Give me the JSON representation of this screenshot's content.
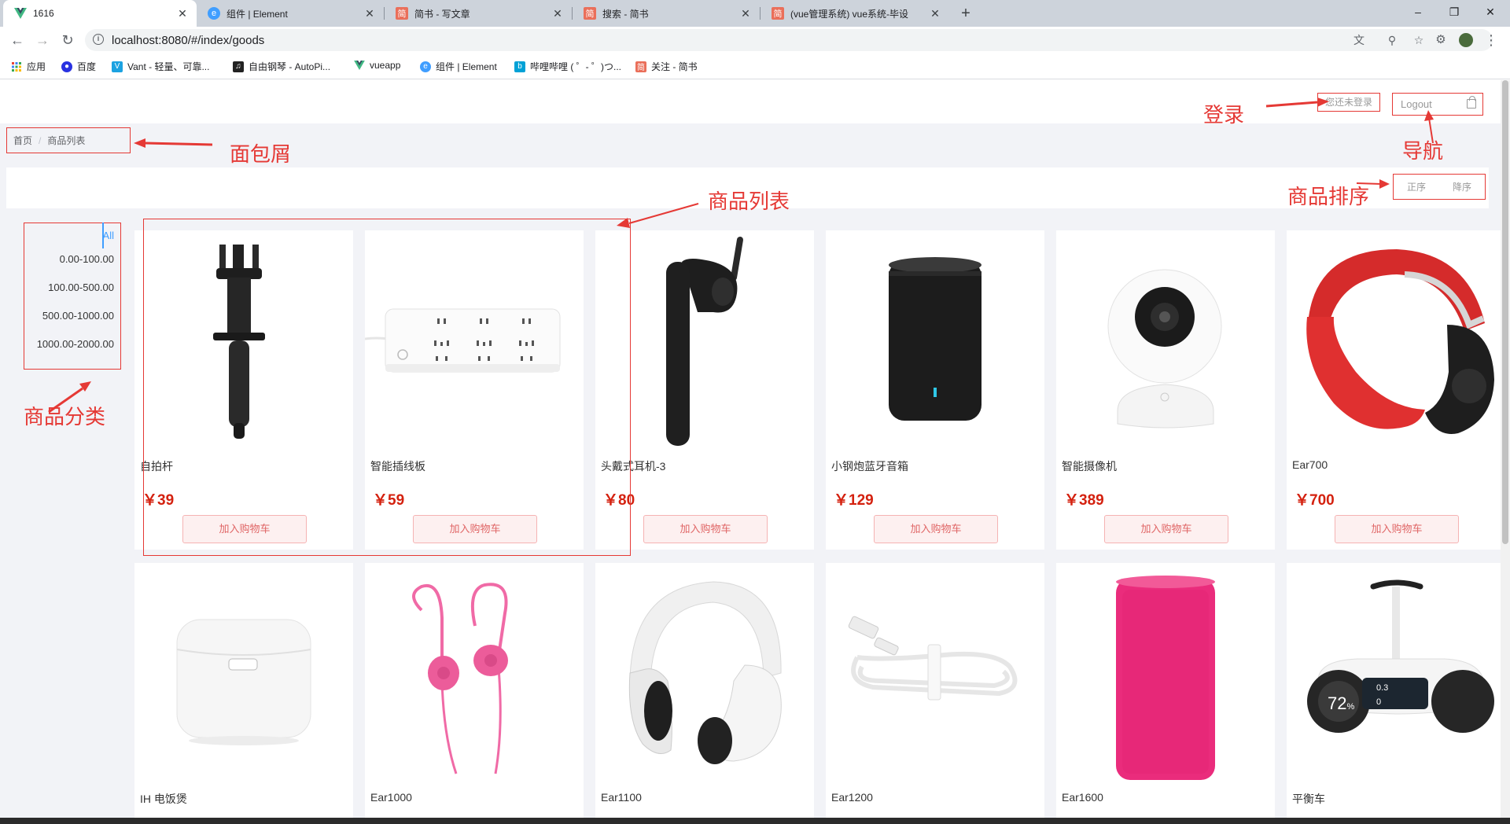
{
  "tabs": [
    {
      "title": "1616",
      "icon": "vue-logo-icon",
      "active": true
    },
    {
      "title": "组件 | Element",
      "icon": "element-logo-icon"
    },
    {
      "title": "简书 - 写文章",
      "icon": "jianshu-logo-icon"
    },
    {
      "title": "搜索 - 简书",
      "icon": "jianshu-logo-icon"
    },
    {
      "title": "(vue管理系统) vue系统-毕设",
      "icon": "jianshu-logo-icon"
    }
  ],
  "address": {
    "url": "localhost:8080/#/index/goods"
  },
  "bookmarks": [
    {
      "label": "应用",
      "icon": "apps-grid-icon"
    },
    {
      "label": "百度",
      "icon": "baidu-paw-icon"
    },
    {
      "label": "Vant - 轻量、可靠...",
      "icon": "vant-logo-icon"
    },
    {
      "label": "自由钢琴 - AutoPi...",
      "icon": "piano-icon"
    },
    {
      "label": "vueapp",
      "icon": "vue-logo-icon"
    },
    {
      "label": "组件 | Element",
      "icon": "element-logo-icon"
    },
    {
      "label": "哔哩哔哩 ( ゜- ゜)つ...",
      "icon": "bilibili-logo-icon"
    },
    {
      "label": "关注 - 简书",
      "icon": "jianshu-logo-icon"
    }
  ],
  "header": {
    "login_status": "您还未登录",
    "logout_label": "Logout"
  },
  "breadcrumb": {
    "home": "首页",
    "current": "商品列表",
    "separator": "/"
  },
  "sort": {
    "asc": "正序",
    "desc": "降序"
  },
  "categories": [
    "All",
    "0.00-100.00",
    "100.00-500.00",
    "500.00-1000.00",
    "1000.00-2000.00"
  ],
  "add_to_cart_label": "加入购物车",
  "products": [
    {
      "name": "自拍杆",
      "price": "￥39",
      "image": "selfie-stick-image"
    },
    {
      "name": "智能插线板",
      "price": "￥59",
      "image": "power-strip-image"
    },
    {
      "name": "头戴式耳机-3",
      "price": "￥80",
      "image": "bluetooth-earpiece-image"
    },
    {
      "name": "小钢炮蓝牙音箱",
      "price": "￥129",
      "image": "speaker-image"
    },
    {
      "name": "智能摄像机",
      "price": "￥389",
      "image": "camera-image"
    },
    {
      "name": "Ear700",
      "price": "￥700",
      "image": "red-headphones-image"
    },
    {
      "name": "IH 电饭煲",
      "image": "rice-cooker-image"
    },
    {
      "name": "Ear1000",
      "image": "pink-earphones-image"
    },
    {
      "name": "Ear1100",
      "image": "white-headphones-image"
    },
    {
      "name": "Ear1200",
      "image": "usb-cable-image"
    },
    {
      "name": "Ear1600",
      "image": "pink-speaker-image"
    },
    {
      "name": "平衡车",
      "image": "balance-scooter-image",
      "display_speed": "72",
      "display_unit": "%",
      "display_a": "0.3",
      "display_b": "0"
    }
  ],
  "annotations": {
    "login": "登录",
    "breadcrumb": "面包屑",
    "nav": "导航",
    "list": "商品列表",
    "sort": "商品排序",
    "category": "商品分类"
  },
  "colors": {
    "accent_red": "#e53935",
    "price_red": "#d4210f",
    "active_blue": "#409eff",
    "page_bg": "#f2f3f7"
  }
}
